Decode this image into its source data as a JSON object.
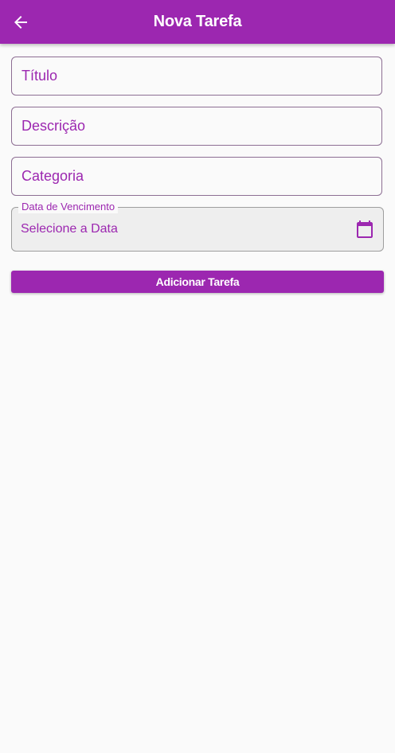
{
  "appbar": {
    "title": "Nova Tarefa",
    "back_icon": "arrow-left-icon",
    "background_color": "#9c27b0"
  },
  "form": {
    "title_placeholder": "Título",
    "description_placeholder": "Descrição",
    "category_placeholder": "Categoria",
    "title_value": "",
    "description_value": "",
    "category_value": "",
    "due_date": {
      "label": "Data de Vencimento",
      "value": "Selecione a Data",
      "icon": "calendar-icon"
    },
    "submit_label": "Adicionar Tarefa"
  },
  "colors": {
    "accent": "#9c27b0",
    "background": "#fafafa"
  }
}
